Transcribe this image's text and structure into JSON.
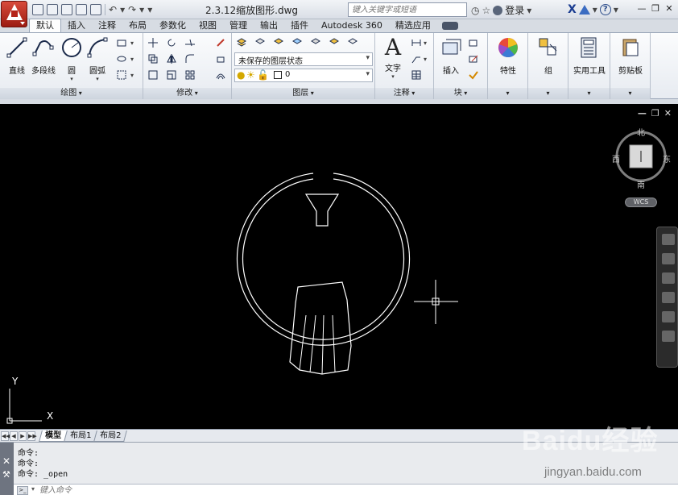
{
  "titlebar": {
    "doc_title": "2.3.12缩放图形.dwg",
    "search_placeholder": "键入关键字或短语",
    "login_label": "登录"
  },
  "ribbon_tabs": [
    "默认",
    "插入",
    "注释",
    "布局",
    "参数化",
    "视图",
    "管理",
    "输出",
    "插件",
    "Autodesk 360",
    "精选应用"
  ],
  "ribbon_active_tab": 0,
  "panels": {
    "draw": {
      "title": "绘图",
      "buttons": [
        "直线",
        "多段线",
        "圆",
        "圆弧"
      ]
    },
    "modify": {
      "title": "修改"
    },
    "layers": {
      "title": "图层",
      "layer_state": "未保存的图层状态",
      "current_layer": "0"
    },
    "annotation": {
      "title": "注释",
      "text_button": "文字"
    },
    "block": {
      "title": "块",
      "insert_button": "插入"
    },
    "properties": {
      "button": "特性"
    },
    "groups": {
      "button": "组"
    },
    "utilities": {
      "button": "实用工具"
    },
    "clipboard": {
      "button": "剪贴板"
    }
  },
  "viewcube": {
    "north": "北",
    "south": "南",
    "east": "东",
    "west": "西",
    "wcs_label": "WCS"
  },
  "ucs": {
    "x_label": "X",
    "y_label": "Y"
  },
  "layout_tabs": [
    "模型",
    "布局1",
    "布局2"
  ],
  "layout_active": 0,
  "command_history": [
    "命令:",
    "命令:",
    "命令: _open"
  ],
  "command_placeholder": "键入命令",
  "watermark": {
    "main": "Baidu经验",
    "sub": "jingyan.baidu.com"
  },
  "colors": {
    "canvas": "#000000",
    "app_button": "#c0392b",
    "drawing_lines": "#ffffff"
  }
}
